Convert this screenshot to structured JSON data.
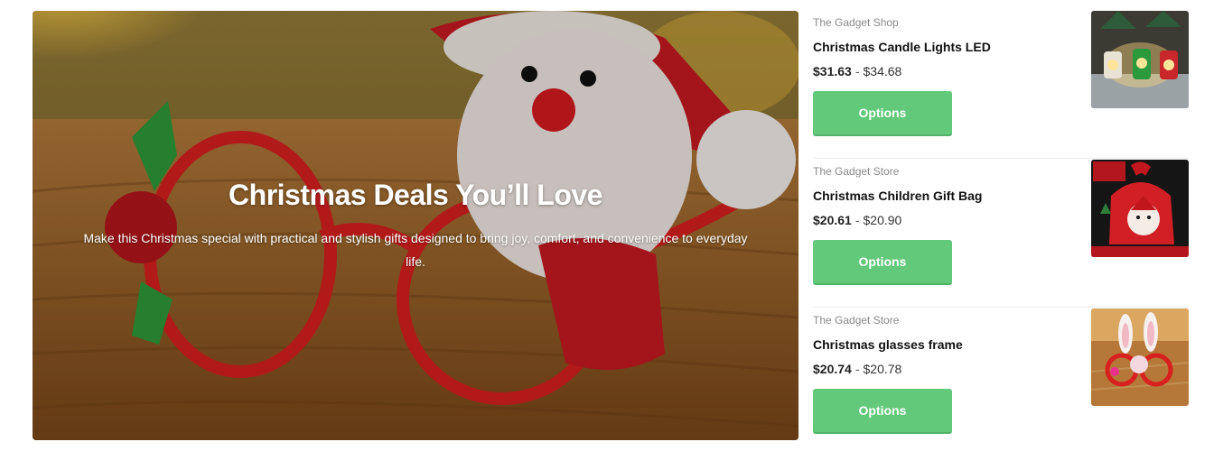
{
  "hero": {
    "title": "Christmas Deals You’ll Love",
    "subtitle": "Make this Christmas special with practical and stylish gifts designed to bring joy, comfort, and convenience to everyday life.",
    "image": "santa-glasses-photo"
  },
  "products": [
    {
      "shop": "The Gadget Shop",
      "name": "Christmas Candle Lights LED",
      "price_low": "$31.63",
      "price_sep": "-",
      "price_high": "$34.68",
      "button_label": "Options",
      "image": "candle-lights-photo"
    },
    {
      "shop": "The Gadget Store",
      "name": "Christmas Children Gift Bag",
      "price_low": "$20.61",
      "price_sep": "-",
      "price_high": "$20.90",
      "button_label": "Options",
      "image": "gift-bag-photo"
    },
    {
      "shop": "The Gadget Store",
      "name": "Christmas glasses frame",
      "price_low": "$20.74",
      "price_sep": "-",
      "price_high": "$20.78",
      "button_label": "Options",
      "image": "glasses-frame-photo"
    }
  ],
  "colors": {
    "button": "#62c97a",
    "text_dark": "#111111",
    "text_muted": "#8a8a8a"
  }
}
